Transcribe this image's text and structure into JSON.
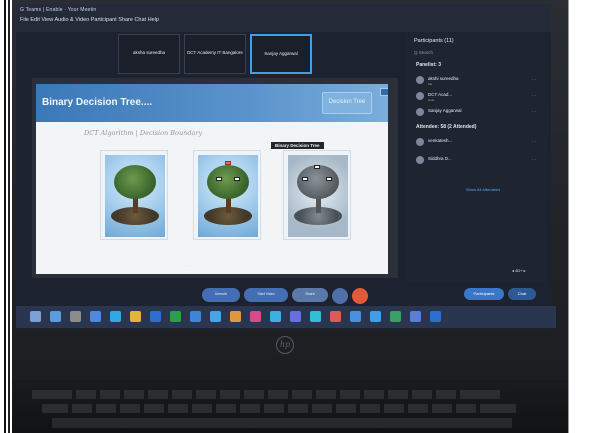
{
  "window": {
    "menu_line1": "G  Teams  |  Enable  ·  Your Meetin",
    "menu_line2": "File  Edit  View  Audio & Video  Participant  Share  Chat  Help"
  },
  "video_tiles": [
    {
      "label": "aksha sureedha"
    },
    {
      "label": "DCT Academy IT Bangalore"
    },
    {
      "label": "Sanjay Aggarwal"
    }
  ],
  "slide": {
    "title": "Binary Decision Tree....",
    "tag": "Decision Tree",
    "handwriting": "DCT   Algorithm  |  Decision Boundary",
    "bdt_label": "Binary Decision Tree"
  },
  "panel": {
    "title": "Participants (11)",
    "search": "Q  Search",
    "section1": "Panelist: 3",
    "participants": [
      {
        "name": "akshi sureedha",
        "sub": "Me",
        "icons": "·  ·"
      },
      {
        "name": "DCT Acad...",
        "sub": "Host",
        "icons": "·  ·"
      },
      {
        "name": "Sanjay Aggarwal",
        "sub": "",
        "icons": "·  ·"
      }
    ],
    "section2": "Attendee: 58 (2 Attended)",
    "attendees": [
      {
        "name": "venkatesh...",
        "icons": "·    ·"
      },
      {
        "name": "Siddhra D...",
        "icons": "·    ·"
      }
    ],
    "link": "Show All Attendees",
    "bottom": {
      "participants": "Participants",
      "chat": "Chat"
    }
  },
  "toolbar": {
    "b1": "Unmute",
    "b2": "Start Video",
    "b3": "Share"
  },
  "zoom": "◂ 4D+ ▸",
  "logo": "hp",
  "colors": {
    "screen_bg": "#1d2230",
    "slide_header": "#3b78b8",
    "accent": "#3977c9",
    "end_button": "#e25a3a"
  }
}
